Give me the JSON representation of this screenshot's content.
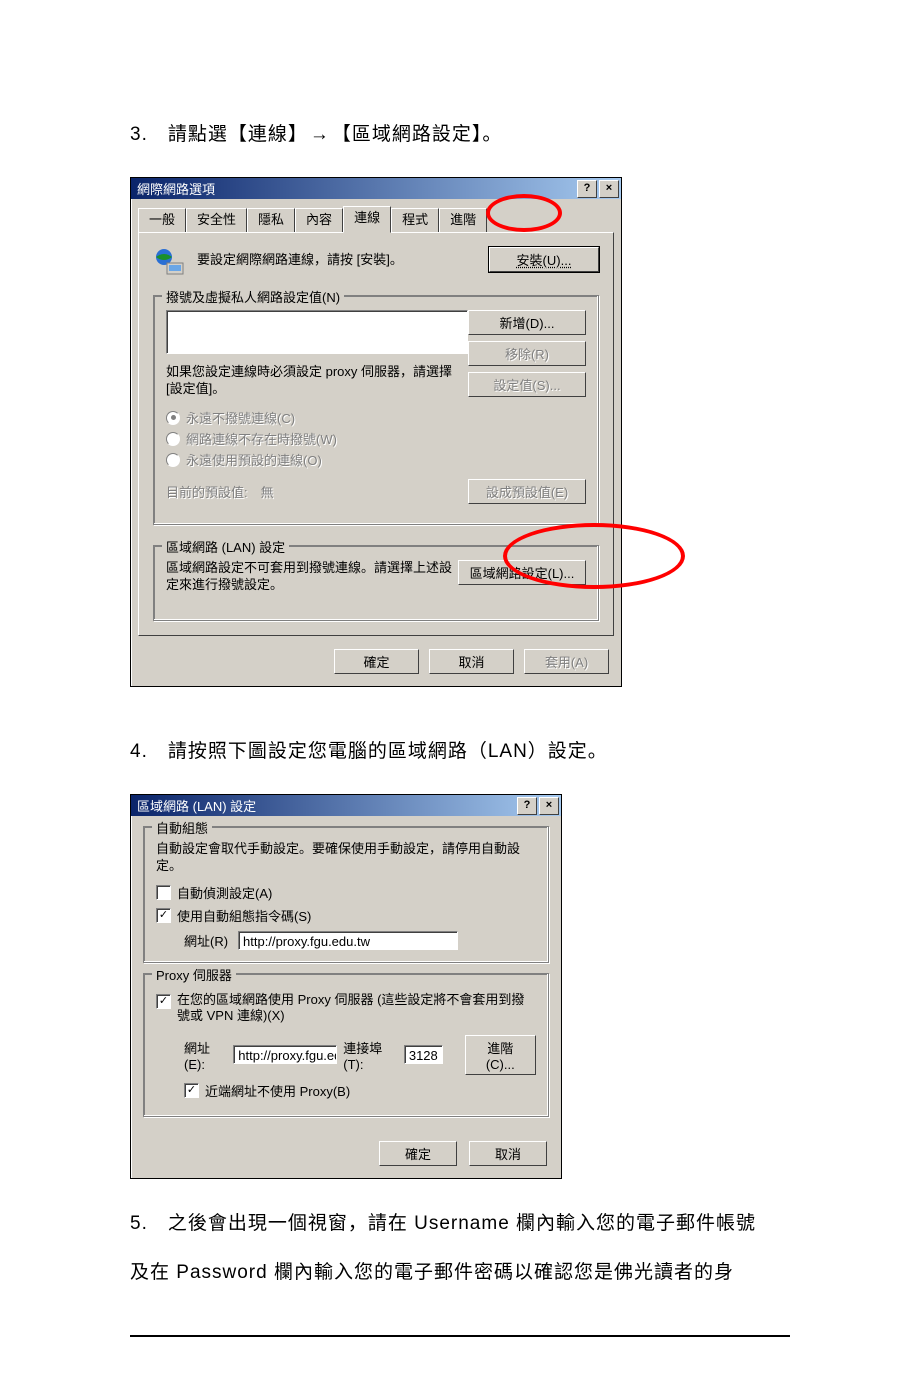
{
  "step3": {
    "prefix": "3.　請點選【連線】",
    "arrow": "→",
    "suffix": "【區域網路設定】。"
  },
  "dialog1": {
    "title": "網際網路選項",
    "help": "?",
    "close": "×",
    "tabs": {
      "general": "一般",
      "security": "安全性",
      "privacy": "隱私",
      "content": "內容",
      "connections": "連線",
      "programs": "程式",
      "advanced": "進階"
    },
    "setup_text": "要設定網際網路連線，請按 [安裝]。",
    "install_btn": "安裝(U)...",
    "dial_group_legend": "撥號及虛擬私人網路設定值(N)",
    "add_btn": "新增(D)...",
    "remove_btn": "移除(R)",
    "settings_btn": "設定值(S)...",
    "proxy_note": "如果您設定連線時必須設定 proxy 伺服器，請選擇 [設定值]。",
    "radio1": "永遠不撥號連線(C)",
    "radio2": "網路連線不存在時撥號(W)",
    "radio3": "永遠使用預設的連線(O)",
    "default_label": "目前的預設值:　無",
    "default_btn": "設成預設值(E)",
    "lan_legend": "區域網路 (LAN) 設定",
    "lan_note": "區域網路設定不可套用到撥號連線。請選擇上述設定來進行撥號設定。",
    "lan_btn": "區域網路設定(L)...",
    "ok": "確定",
    "cancel": "取消",
    "apply": "套用(A)"
  },
  "step4": "4.　請按照下圖設定您電腦的區域網路（LAN）設定。",
  "dialog2": {
    "title": "區域網路 (LAN) 設定",
    "help": "?",
    "close": "×",
    "auto_legend": "自動組態",
    "auto_note": "自動設定會取代手動設定。要確保使用手動設定，請停用自動設定。",
    "auto_detect": "自動偵測設定(A)",
    "auto_script": "使用自動組態指令碼(S)",
    "addr_label": "網址(R)",
    "addr_value": "http://proxy.fgu.edu.tw",
    "proxy_legend": "Proxy 伺服器",
    "proxy_use": "在您的區域網路使用 Proxy 伺服器 (這些設定將不會套用到撥號或 VPN 連線)(X)",
    "proxy_addr_label": "網址(E):",
    "proxy_addr_value": "http://proxy.fgu.edu.tw",
    "proxy_port_label": "連接埠(T):",
    "proxy_port_value": "3128",
    "advanced_btn": "進階(C)...",
    "bypass_local": "近端網址不使用 Proxy(B)",
    "ok": "確定",
    "cancel": "取消"
  },
  "step5_line1": "5.　之後會出現一個視窗，請在 Username 欄內輸入您的電子郵件帳號",
  "step5_line2": "及在 Password 欄內輸入您的電子郵件密碼以確認您是佛光讀者的身"
}
